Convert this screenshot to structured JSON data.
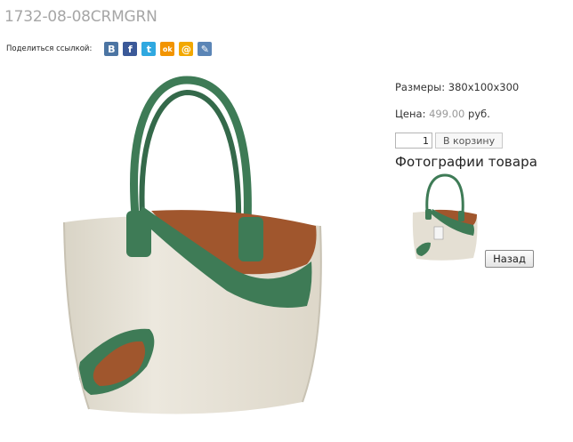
{
  "product": {
    "title": "1732-08-08CRMGRN"
  },
  "share": {
    "label": "Поделиться ссылкой:",
    "buttons": [
      {
        "icon": "vkontakte-icon",
        "glyph": "B",
        "color": "#4c75a3"
      },
      {
        "icon": "facebook-icon",
        "glyph": "f",
        "color": "#3b5998"
      },
      {
        "icon": "twitter-icon",
        "glyph": "t",
        "color": "#2fa8e0"
      },
      {
        "icon": "odnoklassniki-icon",
        "glyph": "ok",
        "color": "#f29400"
      },
      {
        "icon": "mailru-icon",
        "glyph": "@",
        "color": "#f2a800"
      },
      {
        "icon": "livejournal-icon",
        "glyph": "✎",
        "color": "#5b85b6"
      }
    ]
  },
  "info": {
    "size_label": "Размеры: 380x100x300",
    "price_label": "Цена:",
    "price_value": "499.00",
    "price_currency": "руб."
  },
  "cart": {
    "quantity": "1",
    "button_label": "В корзину"
  },
  "photos": {
    "heading": "Фотографии товара"
  },
  "back_button": "Назад",
  "colors": {
    "bag_cream": "#e4dfd3",
    "bag_green": "#3e7b56",
    "bag_brown": "#a0562d"
  }
}
